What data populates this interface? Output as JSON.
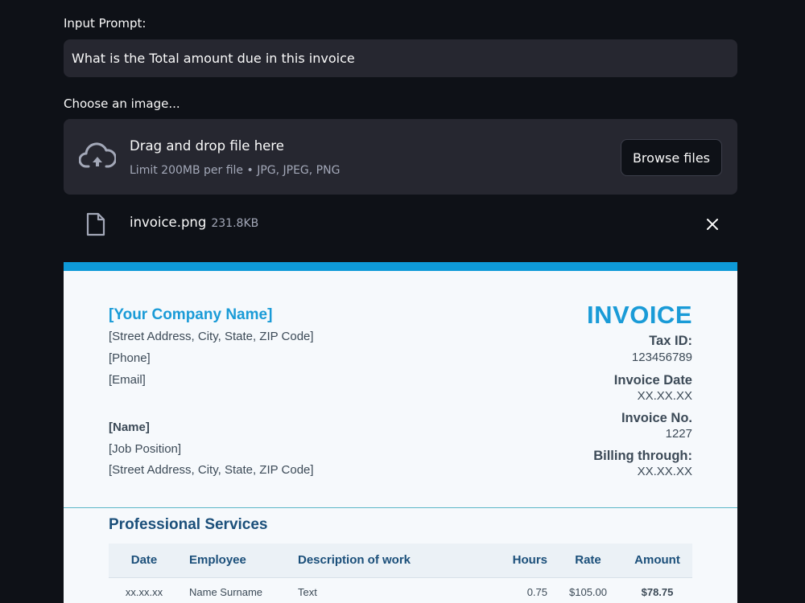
{
  "prompt": {
    "label": "Input Prompt:",
    "value": "What is the Total amount due in this invoice"
  },
  "uploader": {
    "label": "Choose an image...",
    "drop_title": "Drag and drop file here",
    "limit_text": "Limit 200MB per file • JPG, JPEG, PNG",
    "browse_label": "Browse files",
    "file": {
      "name": "invoice.png",
      "size": "231.8KB"
    }
  },
  "invoice": {
    "company": "[Your Company Name]",
    "address": "[Street Address, City, State, ZIP Code]",
    "phone": "[Phone]",
    "email": "[Email]",
    "name": "[Name]",
    "job_position": "[Job Position]",
    "name_address": "[Street Address, City, State, ZIP Code]",
    "title": "INVOICE",
    "tax_id_label": "Tax ID:",
    "tax_id": "123456789",
    "invoice_date_label": "Invoice Date",
    "invoice_date": "XX.XX.XX",
    "invoice_no_label": "Invoice No.",
    "invoice_no": "1227",
    "billing_label": "Billing through:",
    "billing": "XX.XX.XX",
    "section_title": "Professional Services",
    "columns": [
      "Date",
      "Employee",
      "Description of work",
      "Hours",
      "Rate",
      "Amount"
    ],
    "rows": [
      [
        "xx.xx.xx",
        "Name Surname",
        "Text",
        "0.75",
        "$105.00",
        "$78.75"
      ]
    ]
  },
  "colors": {
    "background": "#0e1117",
    "widget": "#262730",
    "invoice_accent": "#1a9bd7",
    "invoice_heading": "#1b4f7a"
  }
}
